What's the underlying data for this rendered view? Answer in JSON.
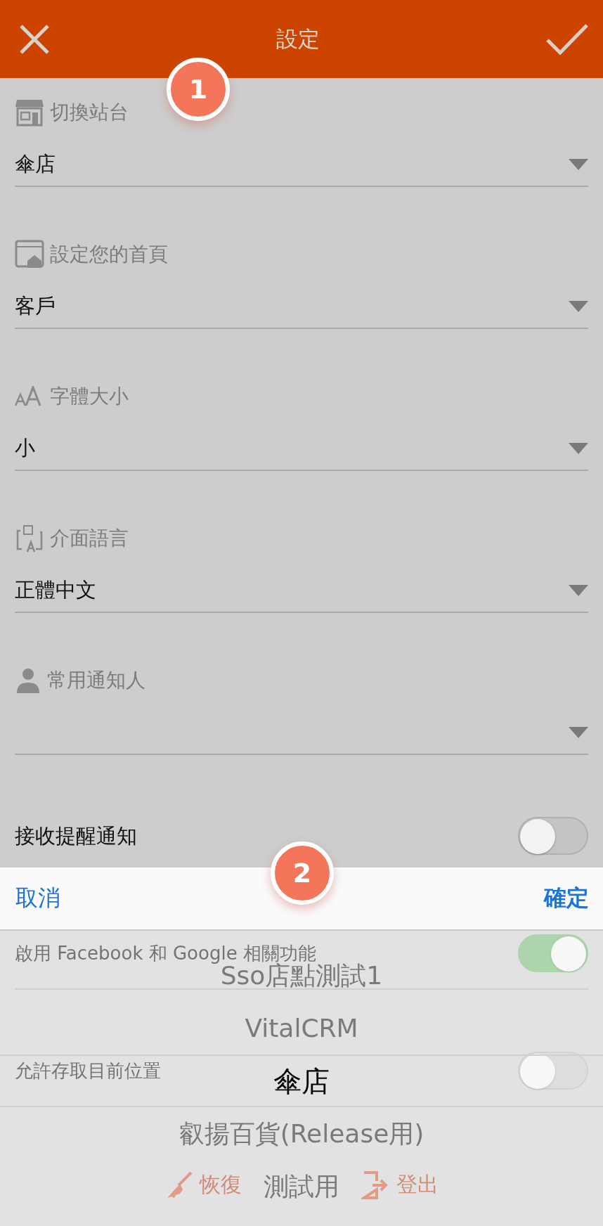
{
  "header": {
    "title": "設定"
  },
  "selects": [
    {
      "label": "切換站台",
      "value": "傘店"
    },
    {
      "label": "設定您的首頁",
      "value": "客戶"
    },
    {
      "label": "字體大小",
      "value": "小"
    },
    {
      "label": "介面語言",
      "value": "正體中文"
    },
    {
      "label": "常用通知人"
    }
  ],
  "toggles": [
    {
      "label": "接收提醒通知",
      "on": false
    },
    {
      "label": "啟用 Facebook 和 Google 相關功能",
      "on": true
    },
    {
      "label": "允許存取目前位置",
      "on": false
    }
  ],
  "actions": [
    {
      "kind": "reset",
      "label": "恢復"
    },
    {
      "kind": "logout",
      "label": "登出"
    }
  ],
  "picker": {
    "cancel": "取消",
    "confirm": "確定",
    "options": [
      {
        "label": "Sso店點測試1",
        "selected": false
      },
      {
        "label": "VitalCRM",
        "selected": false
      },
      {
        "label": "傘店",
        "selected": true
      },
      {
        "label": "叡揚百貨(Release用)",
        "selected": false
      },
      {
        "label": "測試用",
        "selected": false
      }
    ]
  },
  "callouts": [
    "1",
    "2"
  ]
}
